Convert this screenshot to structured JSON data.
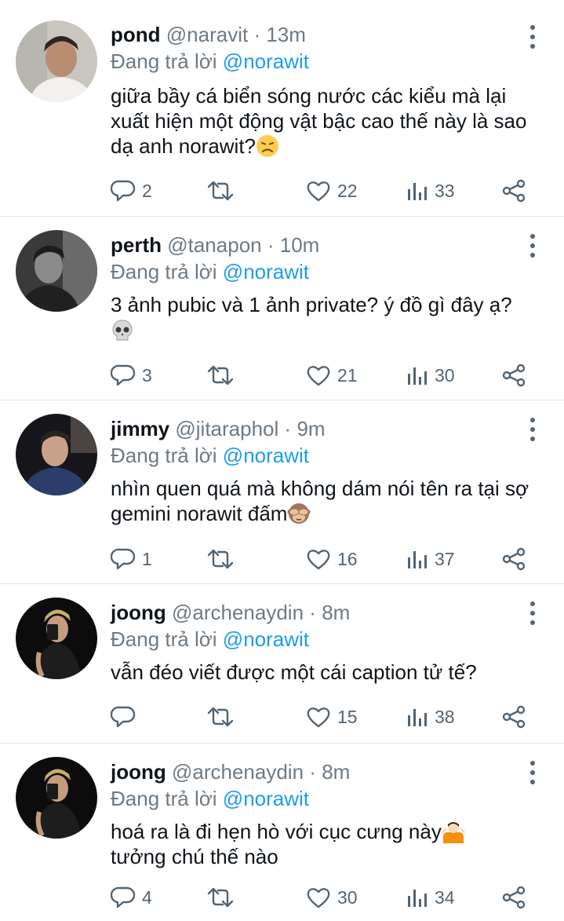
{
  "reply_prefix": "Đang trả lời",
  "tweets": [
    {
      "name": "pond",
      "handle": "@naravit",
      "time": "13m",
      "reply_to": "@norawit",
      "text": "giữa bầy cá biển sóng nước các kiểu mà lại xuất hiện một động vật bậc cao thế này là sao dạ anh norawit?",
      "emoji": "disappointed-face",
      "replies": "2",
      "likes": "22",
      "views": "33"
    },
    {
      "name": "perth",
      "handle": "@tanapon",
      "time": "10m",
      "reply_to": "@norawit",
      "text": "3 ảnh pubic và 1 ảnh private? ý đồ gì đây ạ?",
      "emoji": "skull",
      "replies": "3",
      "likes": "21",
      "views": "30"
    },
    {
      "name": "jimmy",
      "handle": "@jitaraphol",
      "time": "9m",
      "reply_to": "@norawit",
      "text": "nhìn quen quá mà không dám nói tên ra tại sợ gemini norawit đấm",
      "emoji": "see-no-evil-monkey",
      "replies": "1",
      "likes": "16",
      "views": "37"
    },
    {
      "name": "joong",
      "handle": "@archenaydin",
      "time": "8m",
      "reply_to": "@norawit",
      "text": "vẫn đéo viết được một cái caption tử tế?",
      "emoji": "",
      "replies": "",
      "likes": "15",
      "views": "38"
    },
    {
      "name": "joong",
      "handle": "@archenaydin",
      "time": "8m",
      "reply_to": "@norawit",
      "text": "hoá ra là đi hẹn hò với cục cưng này",
      "text2": "tưởng chú thế nào",
      "emoji": "person-shrugging",
      "replies": "4",
      "likes": "30",
      "views": "34"
    }
  ]
}
